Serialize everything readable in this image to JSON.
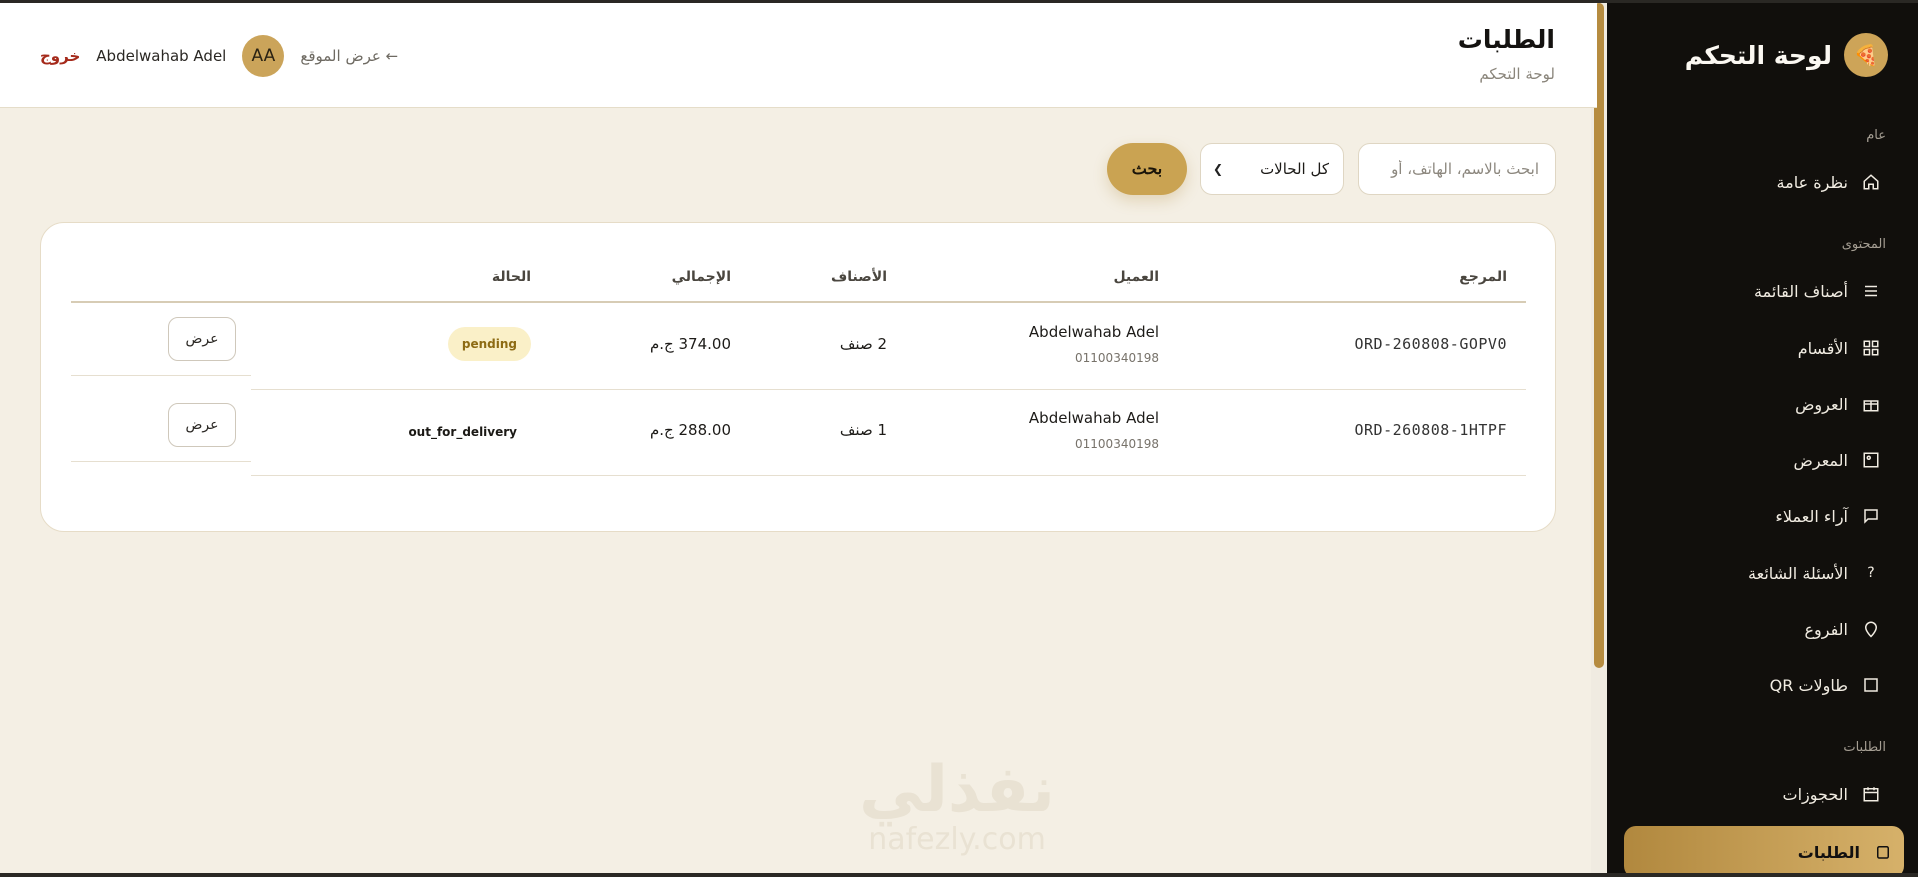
{
  "sidebar": {
    "brand": "لوحة التحكم",
    "sections": {
      "general": "عام",
      "content": "المحتوى",
      "orders": "الطلبات"
    },
    "items": [
      {
        "label": "نظرة عامة",
        "icon": "home-icon"
      },
      {
        "label": "أصناف القائمة",
        "icon": "list-icon"
      },
      {
        "label": "الأقسام",
        "icon": "grid-icon"
      },
      {
        "label": "العروض",
        "icon": "gift-icon"
      },
      {
        "label": "المعرض",
        "icon": "image-icon"
      },
      {
        "label": "آراء العملاء",
        "icon": "chat-icon"
      },
      {
        "label": "الأسئلة الشائعة",
        "icon": "question-icon"
      },
      {
        "label": "الفروع",
        "icon": "location-pin-icon"
      },
      {
        "label": "طاولات QR",
        "icon": "square-icon"
      },
      {
        "label": "الحجوزات",
        "icon": "calendar-icon"
      },
      {
        "label": "الطلبات",
        "icon": "bag-icon",
        "active": true
      }
    ]
  },
  "header": {
    "title": "الطلبات",
    "subtitle": "لوحة التحكم",
    "view_site": "← عرض الموقع",
    "avatar_initials": "AA",
    "username": "Abdelwahab Adel",
    "logout": "خروج"
  },
  "toolbar": {
    "search_placeholder": "ابحث بالاسم، الهاتف، أو",
    "status_filter": "كل الحالات",
    "search_button": "بحث"
  },
  "table": {
    "columns": [
      "المرجع",
      "العميل",
      "الأصناف",
      "الإجمالي",
      "الحالة"
    ],
    "rows": [
      {
        "ref": "ORD-260808-GOPV0",
        "customer": "Abdelwahab Adel",
        "phone": "01100340198",
        "items": "2 صنف",
        "total": "374.00 ج.م",
        "status": "pending",
        "action": "عرض"
      },
      {
        "ref": "ORD-260808-1HTPF",
        "customer": "Abdelwahab Adel",
        "phone": "01100340198",
        "items": "1 صنف",
        "total": "288.00 ج.م",
        "status": "out_for_delivery",
        "action": "عرض"
      }
    ]
  },
  "watermark": {
    "arabic": "نفذلي",
    "latin": "nafezly.com"
  },
  "colors": {
    "accent": "#caa352",
    "sidebar_bg": "#110f0c",
    "page_bg": "#f4efe4",
    "logout": "#a52a1b"
  }
}
